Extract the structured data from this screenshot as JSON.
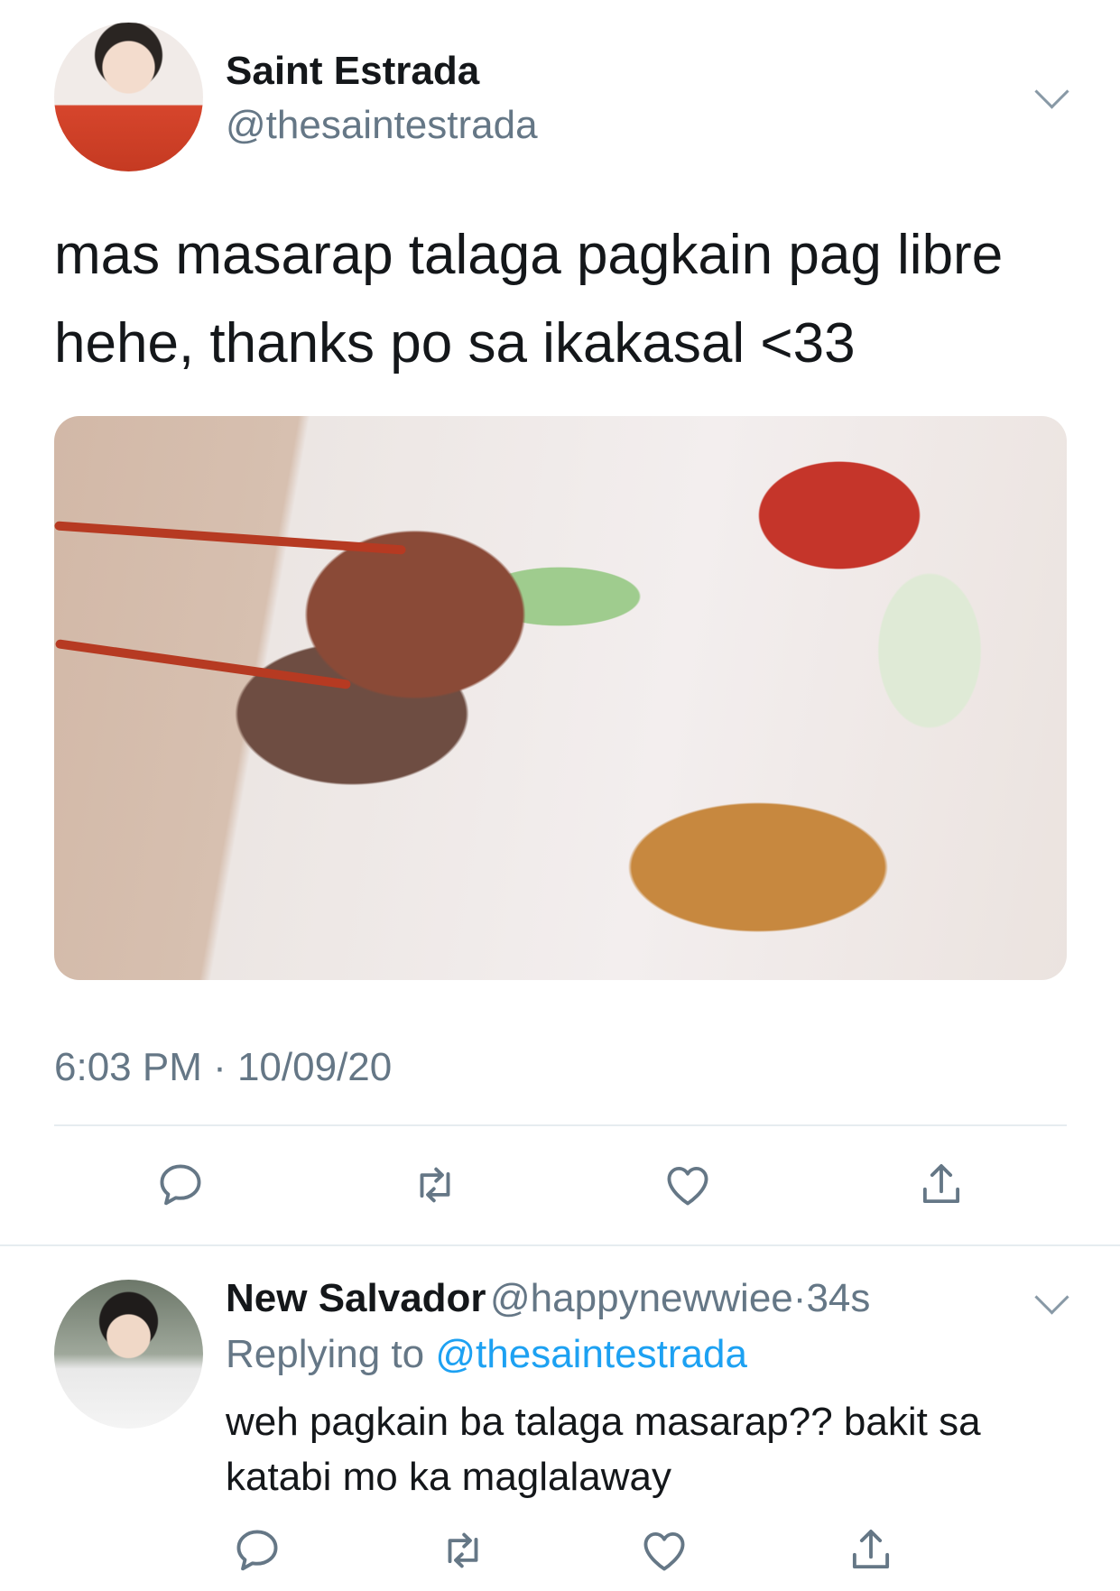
{
  "main_tweet": {
    "name": "Saint Estrada",
    "handle": "@thesaintestrada",
    "text_line1": "mas masarap talaga pagkain pag libre",
    "text_line2": "hehe, thanks po sa ikakasal <33",
    "timestamp": "6:03 PM · 10/09/20"
  },
  "reply": {
    "name": "New Salvador",
    "handle": "@happynewwiee",
    "separator": "·",
    "age": "34s",
    "replying_prefix": "Replying to",
    "replying_handle": "@thesaintestrada",
    "text_line1": "weh pagkain ba talaga masarap?? bakit sa",
    "text_line2": "katabi mo ka maglalaway"
  },
  "icons": {
    "reply": "reply-icon",
    "retweet": "retweet-icon",
    "like": "heart-icon",
    "share": "share-icon",
    "menu": "chevron-down-icon"
  },
  "colors": {
    "text": "#14171a",
    "secondary": "#657786",
    "link": "#1da1f2",
    "divider": "#e6ecf0"
  }
}
